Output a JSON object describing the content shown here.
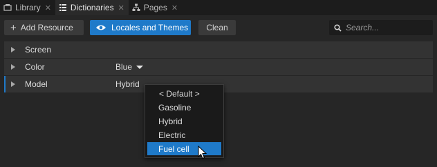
{
  "tabs": [
    {
      "label": "Library",
      "icon": "library-icon",
      "active": false
    },
    {
      "label": "Dictionaries",
      "icon": "dictionaries-icon",
      "active": true
    },
    {
      "label": "Pages",
      "icon": "pages-icon",
      "active": false
    }
  ],
  "toolbar": {
    "add_resource_label": "Add Resource",
    "locales_label": "Locales and Themes",
    "clean_label": "Clean",
    "search_placeholder": "Search..."
  },
  "properties": [
    {
      "label": "Screen",
      "value": ""
    },
    {
      "label": "Color",
      "value": "Blue"
    },
    {
      "label": "Model",
      "value": "Hybrid"
    }
  ],
  "dropdown": {
    "options": [
      "< Default >",
      "Gasoline",
      "Hybrid",
      "Electric",
      "Fuel cell"
    ],
    "highlighted": "Fuel cell"
  },
  "colors": {
    "accent": "#1f7ac9",
    "background": "#262626",
    "row": "#333333",
    "tabbar": "#1c1c1c"
  }
}
